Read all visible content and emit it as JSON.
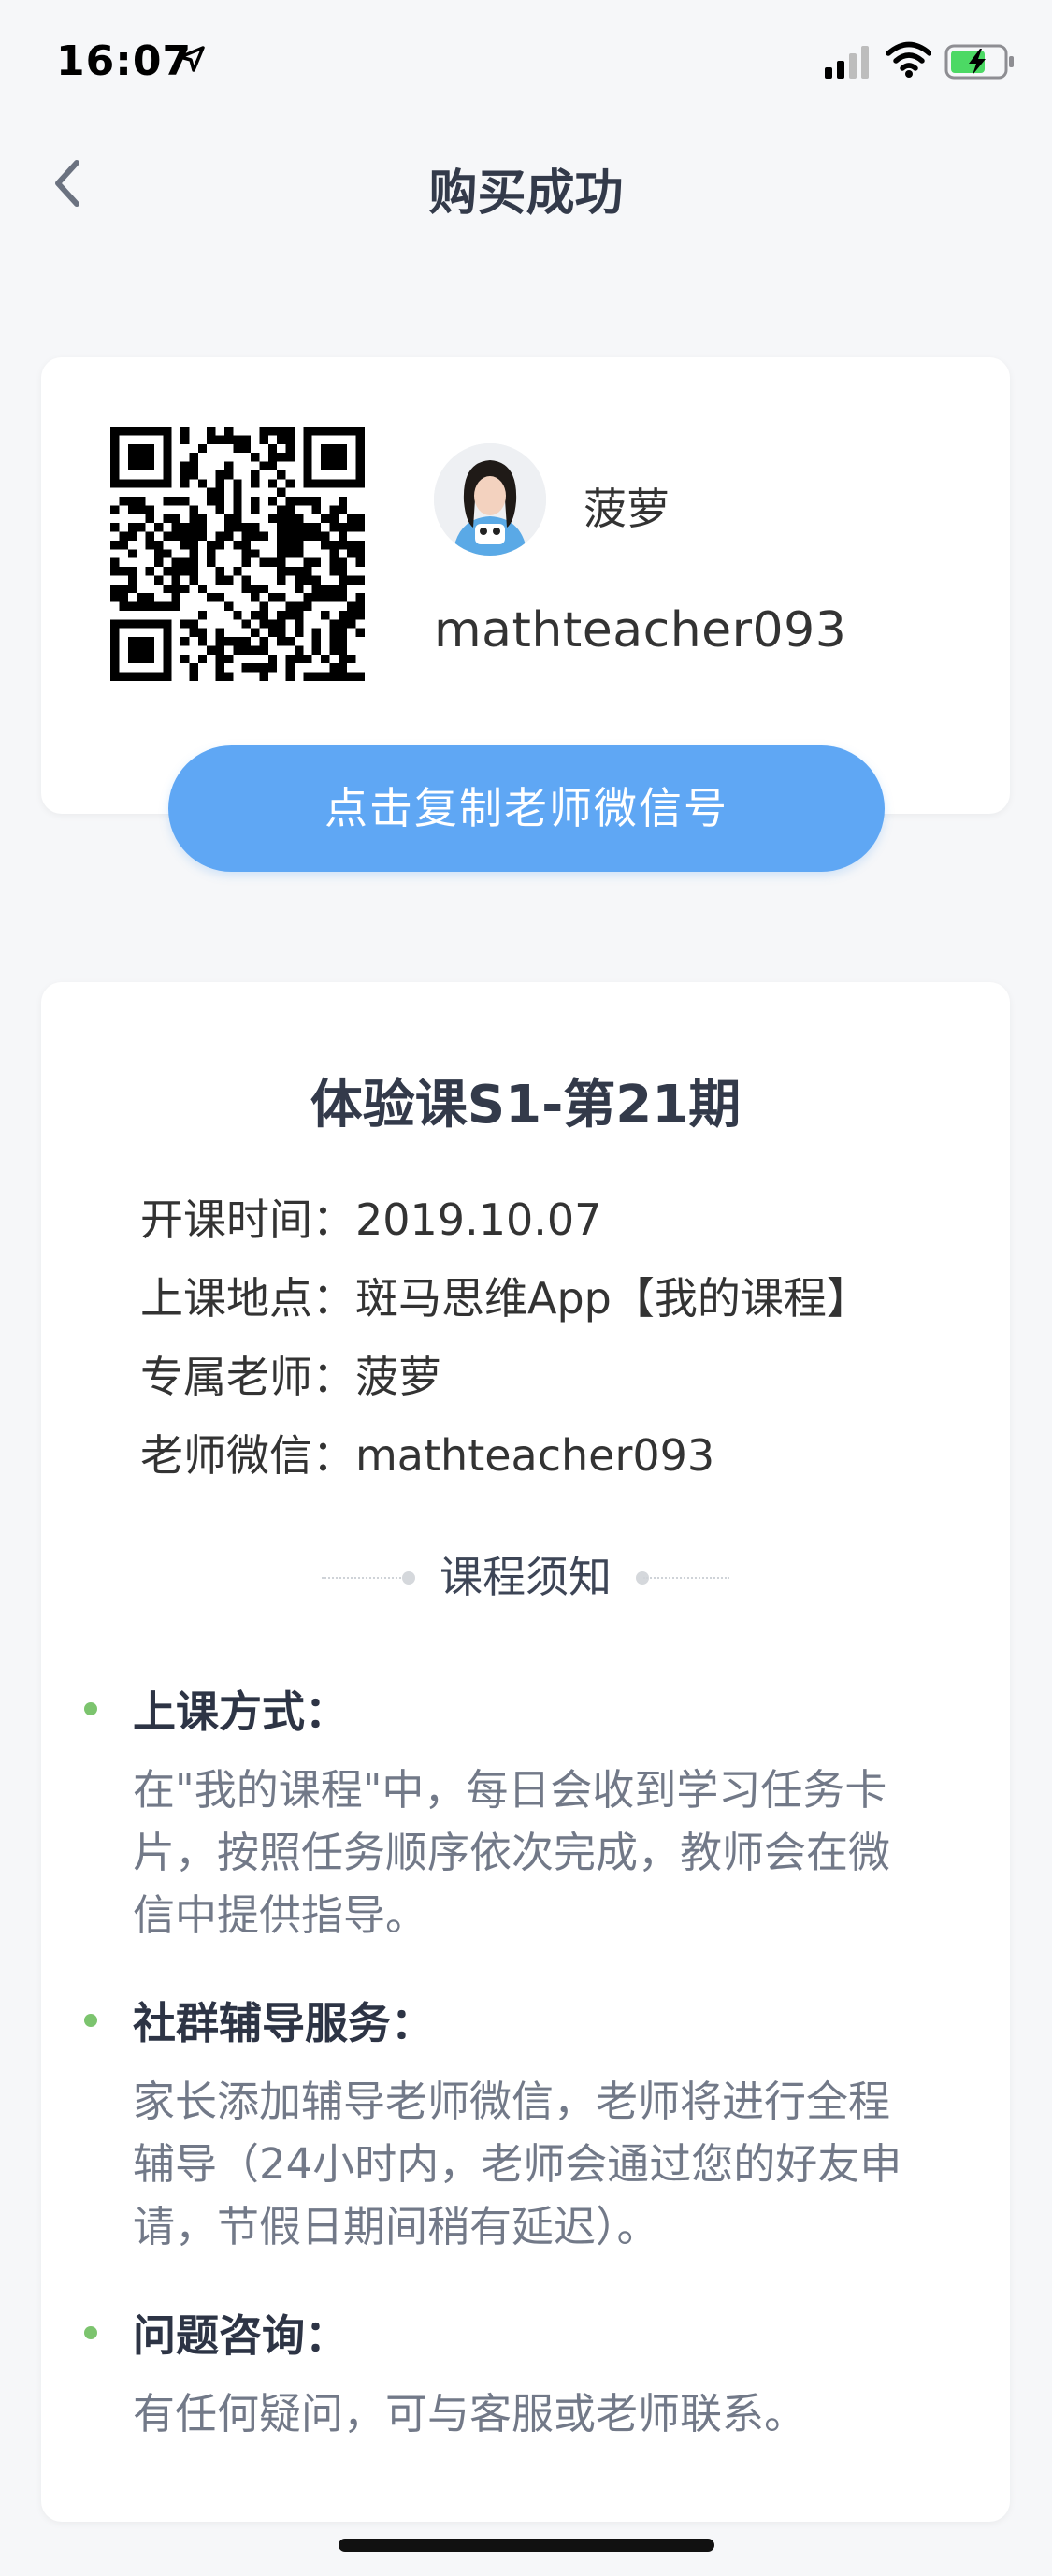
{
  "status_bar": {
    "time": "16:07",
    "icons": [
      "location-arrow-icon",
      "cellular-signal-icon",
      "wifi-icon",
      "battery-charging-icon"
    ],
    "battery_color": "#4cd964"
  },
  "nav": {
    "title": "购买成功",
    "back_icon": "chevron-left-icon"
  },
  "teacher_card": {
    "name": "菠萝",
    "wechat_id": "mathteacher093",
    "copy_button": "点击复制老师微信号",
    "button_color": "#5fa7f4"
  },
  "course": {
    "title": "体验课S1-第21期",
    "info": [
      {
        "label": "开课时间：",
        "value": "2019.10.07"
      },
      {
        "label": "上课地点：",
        "value": "斑马思维App【我的课程】"
      },
      {
        "label": "专属老师：",
        "value": "菠萝"
      },
      {
        "label": "老师微信：",
        "value": "mathteacher093"
      }
    ],
    "notice_heading": "课程须知",
    "sections": [
      {
        "title": "上课方式：",
        "lines": [
          "在\"我的课程\"中，每日会收到学习任务卡",
          "片，按照任务顺序依次完成，教师会在微",
          "信中提供指导。"
        ]
      },
      {
        "title": "社群辅导服务：",
        "lines": [
          "家长添加辅导老师微信，老师将进行全程",
          "辅导（24小时内，老师会通过您的好友申",
          "请，节假日期间稍有延迟）。"
        ]
      },
      {
        "title": "问题咨询：",
        "lines": [
          "有任何疑问，可与客服或老师联系。"
        ]
      }
    ],
    "bullet_color": "#7cc46e"
  }
}
